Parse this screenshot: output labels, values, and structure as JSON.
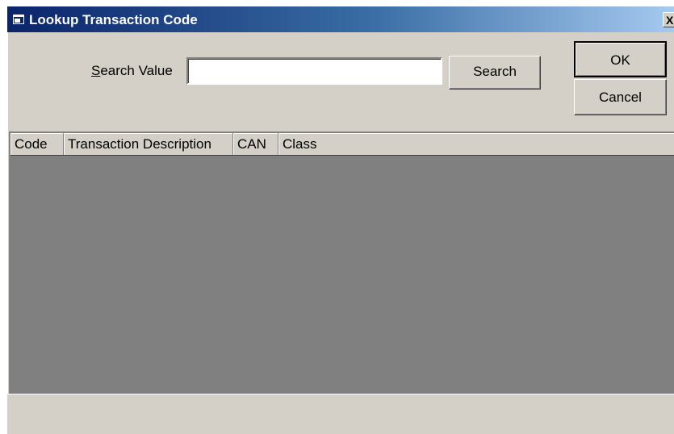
{
  "dialog": {
    "title": "Lookup Transaction Code",
    "close_glyph": "X",
    "icon": "window-icon"
  },
  "search": {
    "label_accel": "S",
    "label_rest": "earch Value",
    "value": "",
    "button_label": "Search"
  },
  "actions": {
    "ok_label": "OK",
    "cancel_label": "Cancel"
  },
  "table": {
    "columns": [
      "Code",
      "Transaction Description",
      "CAN",
      "Class"
    ],
    "rows": []
  },
  "colors": {
    "title_start": "#0a246a",
    "title_end": "#a6caf0",
    "face": "#d4d0c8",
    "grid_background": "#808080"
  }
}
